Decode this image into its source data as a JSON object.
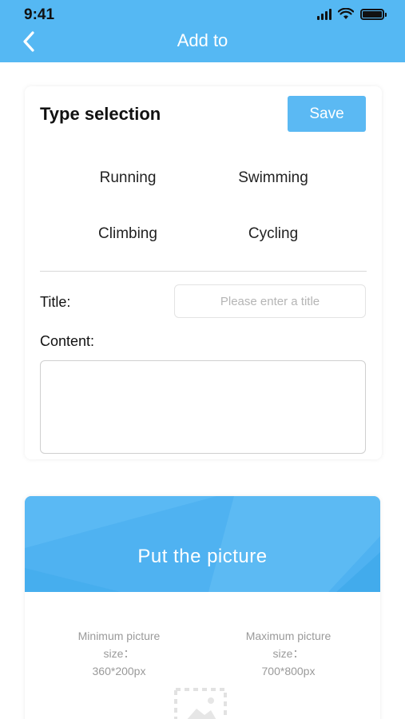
{
  "status_bar": {
    "time": "9:41"
  },
  "nav": {
    "title": "Add to"
  },
  "type_card": {
    "heading": "Type selection",
    "save_label": "Save",
    "types": [
      "Running",
      "Swimming",
      "Climbing",
      "Cycling"
    ]
  },
  "form": {
    "title_label": "Title:",
    "title_placeholder": "Please enter a title",
    "title_value": "",
    "content_label": "Content:",
    "content_value": ""
  },
  "picture": {
    "label": "Put the picture",
    "min_line1": "Minimum picture",
    "min_line2": "size：",
    "min_line3": "360*200px",
    "max_line1": "Maximum picture",
    "max_line2": "size：",
    "max_line3": "700*800px"
  },
  "colors": {
    "accent": "#55b8f3",
    "button": "#5bb9f3",
    "banner": "#4fb2f1"
  },
  "icons": [
    "back-arrow-icon",
    "signal-icon",
    "wifi-icon",
    "battery-icon",
    "image-placeholder-icon"
  ]
}
